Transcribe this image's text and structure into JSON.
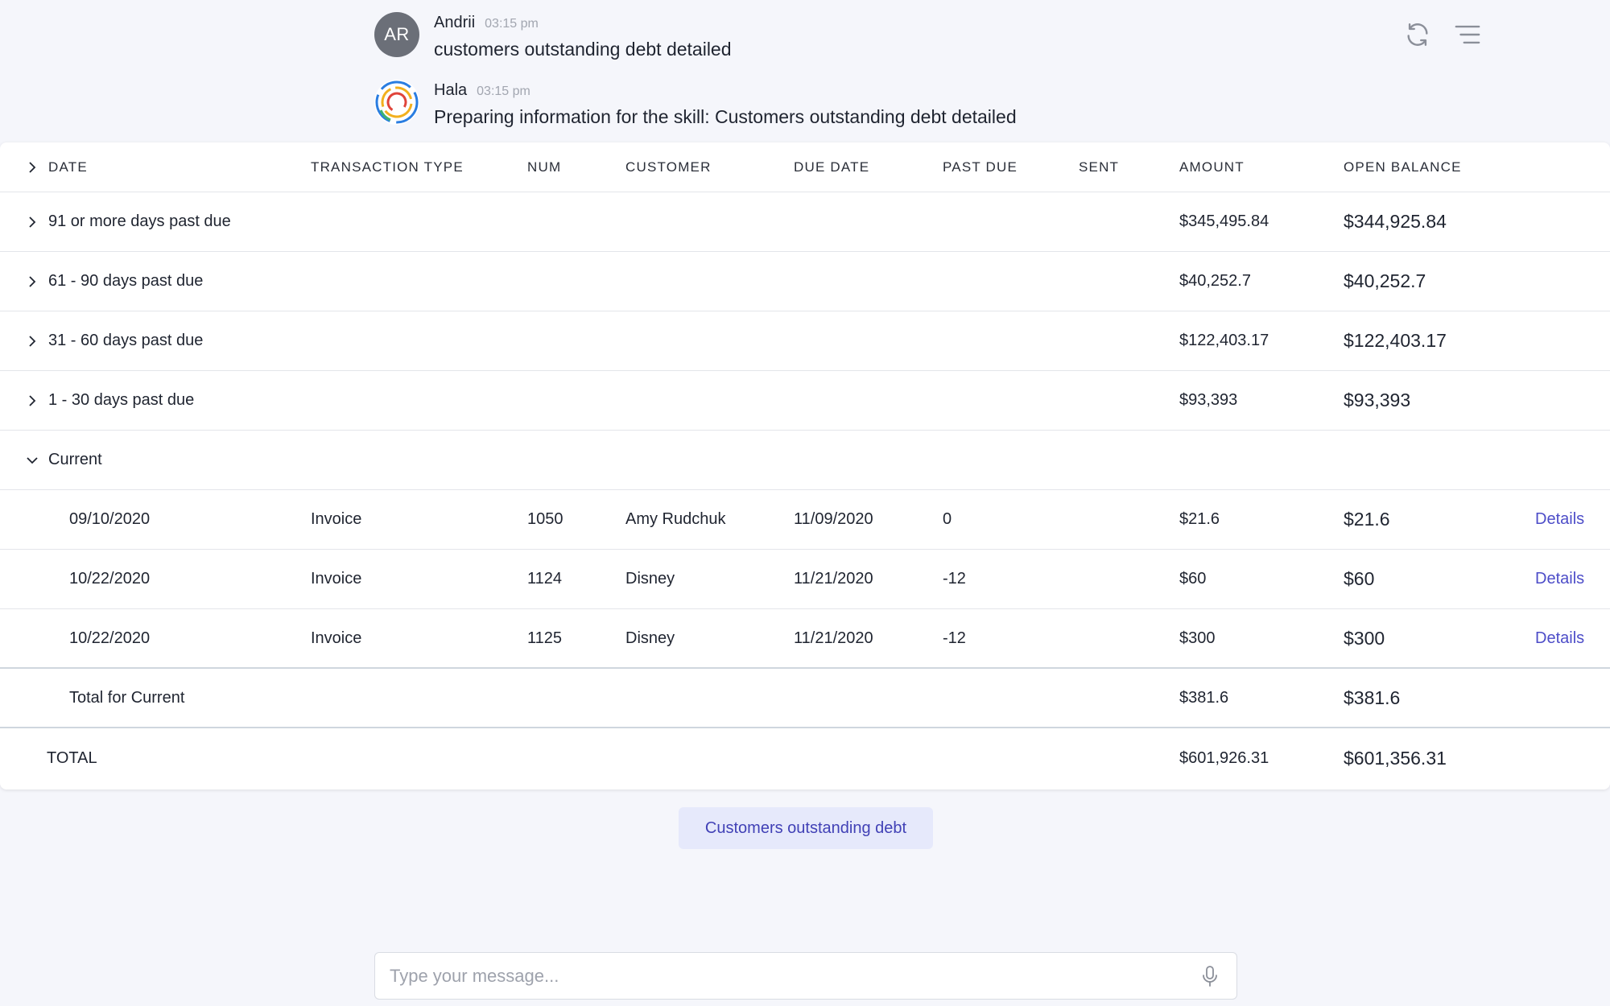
{
  "messages": [
    {
      "avatar_text": "AR",
      "author": "Andrii",
      "time": "03:15 pm",
      "text": "customers outstanding debt detailed"
    },
    {
      "avatar_text": "",
      "author": "Hala",
      "time": "03:15 pm",
      "text": "Preparing information for the skill: Customers outstanding debt detailed"
    }
  ],
  "table": {
    "headers": {
      "date": "DATE",
      "transaction_type": "TRANSACTION TYPE",
      "num": "NUM",
      "customer": "CUSTOMER",
      "due_date": "DUE DATE",
      "past_due": "PAST DUE",
      "sent": "SENT",
      "amount": "AMOUNT",
      "open_balance": "OPEN BALANCE"
    },
    "groups": [
      {
        "label": "91 or more days past due",
        "amount": "$345,495.84",
        "open_balance": "$344,925.84"
      },
      {
        "label": "61 - 90 days past due",
        "amount": "$40,252.7",
        "open_balance": "$40,252.7"
      },
      {
        "label": "31 - 60 days past due",
        "amount": "$122,403.17",
        "open_balance": "$122,403.17"
      },
      {
        "label": "1 - 30 days past due",
        "amount": "$93,393",
        "open_balance": "$93,393"
      },
      {
        "label": "Current"
      }
    ],
    "rows": [
      {
        "date": "09/10/2020",
        "type": "Invoice",
        "num": "1050",
        "customer": "Amy Rudchuk",
        "due_date": "11/09/2020",
        "past_due": "0",
        "amount": "$21.6",
        "open_balance": "$21.6",
        "action": "Details"
      },
      {
        "date": "10/22/2020",
        "type": "Invoice",
        "num": "1124",
        "customer": "Disney",
        "due_date": "11/21/2020",
        "past_due": "-12",
        "amount": "$60",
        "open_balance": "$60",
        "action": "Details"
      },
      {
        "date": "10/22/2020",
        "type": "Invoice",
        "num": "1125",
        "customer": "Disney",
        "due_date": "11/21/2020",
        "past_due": "-12",
        "amount": "$300",
        "open_balance": "$300",
        "action": "Details"
      }
    ],
    "subtotal": {
      "label": "Total for Current",
      "amount": "$381.6",
      "open_balance": "$381.6"
    },
    "total": {
      "label": "TOTAL",
      "amount": "$601,926.31",
      "open_balance": "$601,356.31"
    }
  },
  "chip": {
    "label": "Customers outstanding debt"
  },
  "composer": {
    "placeholder": "Type your message..."
  },
  "icons": {
    "refresh": "refresh-icon",
    "menu": "menu-icon",
    "mic": "microphone-icon",
    "chevron_right": "chevron-right-icon",
    "chevron_down": "chevron-down-icon"
  },
  "colors": {
    "link": "#4d4dc8",
    "chip_bg": "#e6e9fb",
    "chip_text": "#4141b6",
    "page_bg": "#f5f6fb"
  }
}
